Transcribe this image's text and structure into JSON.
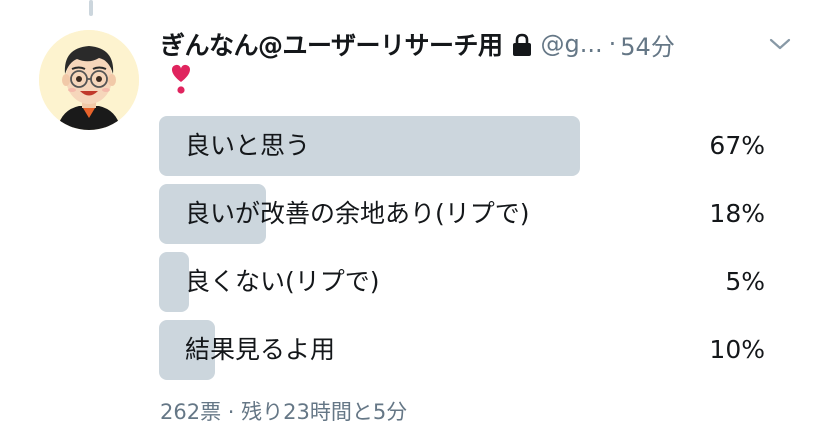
{
  "tweet": {
    "author": {
      "display_name": "ぎんなん@ユーザーリサーチ用",
      "protected_icon": "lock-icon",
      "handle": "@g...",
      "avatar": "avatar-illustration-glasses"
    },
    "separator": "·",
    "time": "54分",
    "menu_icon": "chevron-down-icon",
    "text": "❣️",
    "poll": {
      "options": [
        {
          "label": "良いと思う",
          "percent_text": "67%",
          "percent": 67
        },
        {
          "label": "良いが改善の余地あり(リプで)",
          "percent_text": "18%",
          "percent": 18
        },
        {
          "label": "良くない(リプで)",
          "percent_text": "5%",
          "percent": 5
        },
        {
          "label": "結果見るよ用",
          "percent_text": "10%",
          "percent": 10
        }
      ],
      "votes": "262票",
      "separator": "·",
      "time_left": "残り23時間と5分"
    }
  },
  "colors": {
    "bar": "#ccd6dd",
    "secondary_text": "#657786",
    "primary_text": "#14171a",
    "heart": "#e0245e"
  }
}
